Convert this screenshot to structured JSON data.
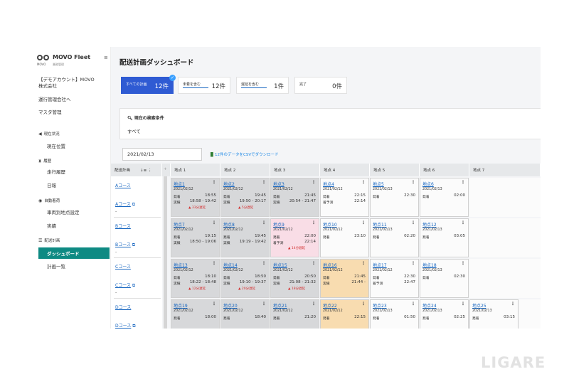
{
  "app": {
    "name": "MOVO Fleet",
    "logo_sub": "MOVO",
    "logo_sub2": "業務管理"
  },
  "sidebar": {
    "account": "【デモアカウント】MOVO\n株式会社",
    "items": [
      "運行管理会社へ",
      "マスタ管理"
    ],
    "sections": [
      {
        "title": "現在状況",
        "icon": "navigate-icon",
        "items": [
          "現在位置"
        ]
      },
      {
        "title": "履歴",
        "icon": "hourglass-icon",
        "items": [
          "走行履歴",
          "日報"
        ]
      },
      {
        "title": "自動着荷",
        "icon": "pin-icon",
        "items": [
          "車両別地点設定",
          "実績"
        ]
      },
      {
        "title": "配送計画",
        "icon": "list-icon",
        "items": [
          "ダッシュボード",
          "計画一覧"
        ]
      }
    ],
    "active": "ダッシュボード"
  },
  "header": {
    "title": "配送計画ダッシュボード"
  },
  "tabs": [
    {
      "label": "すべての計画",
      "count": "12件",
      "active": true
    },
    {
      "label": "未着を含む",
      "count": "12件",
      "active": false
    },
    {
      "label": "遅延を含む",
      "count": "1件",
      "active": false
    },
    {
      "label": "完了",
      "count": "0件",
      "active": false
    }
  ],
  "search": {
    "title": "現在の検索条件",
    "value": "すべて"
  },
  "date": "2021/02/13",
  "csv": "12件のデータをCSVでダウンロード",
  "grid": {
    "course_header": "配送計画",
    "point_headers": [
      "地点 1",
      "地点 2",
      "地点 3",
      "地点 4",
      "地点 5",
      "地点 6",
      "地点 7"
    ],
    "courses": [
      {
        "name": "Aコース",
        "vehicle": "Aコース",
        "dash": "-"
      },
      {
        "name": "Bコース",
        "vehicle": "Bコース",
        "dash": "-"
      },
      {
        "name": "Cコース",
        "vehicle": "Cコース",
        "dash": "-"
      },
      {
        "name": "Dコース",
        "vehicle": "Dコース",
        "dash": "-"
      }
    ],
    "rows": [
      [
        {
          "name": "地点1",
          "date": "2021/02/12",
          "l1": "発着",
          "t1": "18:55",
          "l2": "実績",
          "t2": "18:58 - 19:42",
          "delay": "33分遅延",
          "color": "gray"
        },
        {
          "name": "地点2",
          "date": "2021/02/12",
          "l1": "発着",
          "t1": "19:45",
          "l2": "実績",
          "t2": "19:50 - 20:17",
          "delay": "5分遅延",
          "color": "gray"
        },
        {
          "name": "地点3",
          "date": "2021/02/12",
          "l1": "発着",
          "t1": "21:45",
          "l2": "実績",
          "t2": "20:54 - 21:47",
          "delay": "",
          "color": "gray"
        },
        {
          "name": "地点4",
          "date": "2021/02/12",
          "l1": "発着",
          "t1": "22:15",
          "l2": "着予測",
          "t2": "22:14",
          "delay": "",
          "color": "white"
        },
        {
          "name": "地点5",
          "date": "2021/02/13",
          "l1": "発着",
          "t1": "22:30",
          "l2": "",
          "t2": "",
          "delay": "",
          "color": "white"
        },
        {
          "name": "地点6",
          "date": "2021/02/13",
          "l1": "発着",
          "t1": "02:00",
          "l2": "",
          "t2": "",
          "delay": "",
          "color": "white"
        }
      ],
      [
        {
          "name": "地点7",
          "date": "2021/02/12",
          "l1": "発着",
          "t1": "19:15",
          "l2": "実績",
          "t2": "18:50 - 19:06",
          "delay": "",
          "color": "gray"
        },
        {
          "name": "地点8",
          "date": "2021/02/12",
          "l1": "発着",
          "t1": "19:45",
          "l2": "実績",
          "t2": "19:19 - 19:42",
          "delay": "",
          "color": "gray"
        },
        {
          "name": "地点9",
          "date": "2021/02/12",
          "l1": "発着",
          "t1": "22:00",
          "l2": "着予測",
          "t2": "22:14",
          "delay": "14分遅延",
          "color": "pink"
        },
        {
          "name": "地点10",
          "date": "2021/02/12",
          "l1": "発着",
          "t1": "23:10",
          "l2": "",
          "t2": "",
          "delay": "",
          "color": "white"
        },
        {
          "name": "地点11",
          "date": "2021/02/13",
          "l1": "発着",
          "t1": "02:20",
          "l2": "",
          "t2": "",
          "delay": "",
          "color": "white"
        },
        {
          "name": "地点12",
          "date": "2021/02/13",
          "l1": "発着",
          "t1": "03:05",
          "l2": "",
          "t2": "",
          "delay": "",
          "color": "white"
        }
      ],
      [
        {
          "name": "地点13",
          "date": "2021/02/12",
          "l1": "発着",
          "t1": "18:10",
          "l2": "実績",
          "t2": "18:22 - 18:48",
          "delay": "12分遅延",
          "color": "gray"
        },
        {
          "name": "地点14",
          "date": "2021/02/12",
          "l1": "発着",
          "t1": "18:50",
          "l2": "実績",
          "t2": "19:10 - 19:37",
          "delay": "20分遅延",
          "color": "gray"
        },
        {
          "name": "地点15",
          "date": "2021/02/12",
          "l1": "発着",
          "t1": "20:50",
          "l2": "実績",
          "t2": "21:08 - 21:32",
          "delay": "18分遅延",
          "color": "gray"
        },
        {
          "name": "地点16",
          "date": "2021/02/12",
          "l1": "発着",
          "t1": "21:45",
          "l2": "実績",
          "t2": "21:44 -",
          "delay": "",
          "color": "orange"
        },
        {
          "name": "地点17",
          "date": "2021/02/12",
          "l1": "発着",
          "t1": "22:30",
          "l2": "着予測",
          "t2": "22:47",
          "delay": "",
          "color": "white"
        },
        {
          "name": "地点18",
          "date": "2021/02/13",
          "l1": "発着",
          "t1": "02:30",
          "l2": "",
          "t2": "",
          "delay": "",
          "color": "white"
        }
      ],
      [
        {
          "name": "地点19",
          "date": "2021/02/12",
          "l1": "発着",
          "t1": "18:00",
          "l2": "",
          "t2": "",
          "delay": "",
          "color": "gray"
        },
        {
          "name": "地点20",
          "date": "2021/02/12",
          "l1": "発着",
          "t1": "18:40",
          "l2": "",
          "t2": "",
          "delay": "",
          "color": "gray"
        },
        {
          "name": "地点21",
          "date": "2021/02/12",
          "l1": "発着",
          "t1": "21:20",
          "l2": "",
          "t2": "",
          "delay": "",
          "color": "gray"
        },
        {
          "name": "地点22",
          "date": "2021/02/12",
          "l1": "発着",
          "t1": "22:15",
          "l2": "",
          "t2": "",
          "delay": "",
          "color": "orange"
        },
        {
          "name": "地点23",
          "date": "2021/02/13",
          "l1": "発着",
          "t1": "01:50",
          "l2": "",
          "t2": "",
          "delay": "",
          "color": "white"
        },
        {
          "name": "地点24",
          "date": "2021/02/13",
          "l1": "発着",
          "t1": "02:25",
          "l2": "",
          "t2": "",
          "delay": "",
          "color": "white"
        },
        {
          "name": "地点25",
          "date": "2021/02/13",
          "l1": "発着",
          "t1": "03:15",
          "l2": "",
          "t2": "",
          "delay": "",
          "color": "white"
        }
      ]
    ]
  },
  "watermark": "LIGARE",
  "colors": {
    "accent": "#2f5bd3",
    "active_menu": "#0e8a83",
    "link": "#1565c0",
    "delay": "#d32f2f"
  }
}
